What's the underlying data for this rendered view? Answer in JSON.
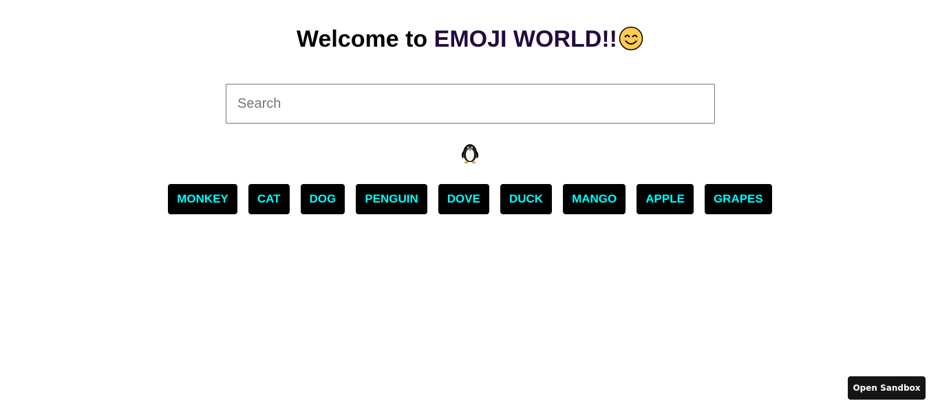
{
  "header": {
    "title_prefix": "Welcome to ",
    "title_brand": "EMOJI WORLD!!",
    "title_icon": "smiling-face-icon"
  },
  "search": {
    "placeholder": "Search",
    "value": ""
  },
  "result": {
    "icon": "penguin-icon"
  },
  "buttons": [
    {
      "label": "MONKEY"
    },
    {
      "label": "CAT"
    },
    {
      "label": "DOG"
    },
    {
      "label": "PENGUIN"
    },
    {
      "label": "DOVE"
    },
    {
      "label": "DUCK"
    },
    {
      "label": "MANGO"
    },
    {
      "label": "APPLE"
    },
    {
      "label": "GRAPES"
    }
  ],
  "sandbox": {
    "label": "Open Sandbox"
  },
  "colors": {
    "brand": "#24093f",
    "button_bg": "#000000",
    "button_text": "#00ffff",
    "sandbox_bg": "#151515"
  }
}
